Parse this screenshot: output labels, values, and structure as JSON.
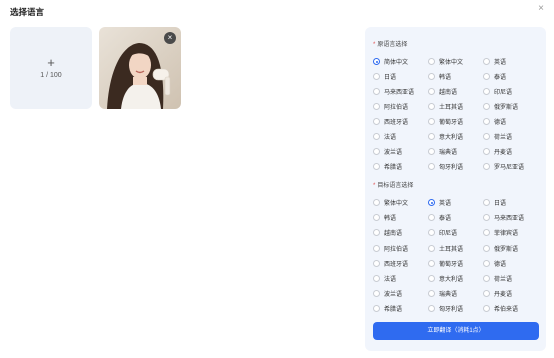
{
  "dialog": {
    "title": "选择语言",
    "close_glyph": "×"
  },
  "upload": {
    "plus": "+",
    "count": "1 / 100"
  },
  "thumbnail": {
    "remove_glyph": "×"
  },
  "source": {
    "title": "原语言选择",
    "required_mark": "*",
    "selected": "简体中文",
    "options": [
      "简体中文",
      "繁体中文",
      "英语",
      "日语",
      "韩语",
      "泰语",
      "马来西亚语",
      "越南语",
      "印尼语",
      "阿拉伯语",
      "土耳其语",
      "俄罗斯语",
      "西班牙语",
      "葡萄牙语",
      "德语",
      "法语",
      "意大利语",
      "荷兰语",
      "波兰语",
      "瑞典语",
      "丹麦语",
      "希腊语",
      "匈牙利语",
      "罗马尼亚语"
    ]
  },
  "target": {
    "title": "目标语言选择",
    "required_mark": "*",
    "selected": "英语",
    "options": [
      "繁体中文",
      "英语",
      "日语",
      "韩语",
      "泰语",
      "马来西亚语",
      "越南语",
      "印尼语",
      "菲律宾语",
      "阿拉伯语",
      "土耳其语",
      "俄罗斯语",
      "西班牙语",
      "葡萄牙语",
      "德语",
      "法语",
      "意大利语",
      "荷兰语",
      "波兰语",
      "瑞典语",
      "丹麦语",
      "希腊语",
      "匈牙利语",
      "希伯来语"
    ]
  },
  "action": {
    "label": "立即翻译（消耗1点）"
  },
  "colors": {
    "accent": "#2f6bf0",
    "panel": "#f1f5fc",
    "required": "#e34d4d"
  }
}
